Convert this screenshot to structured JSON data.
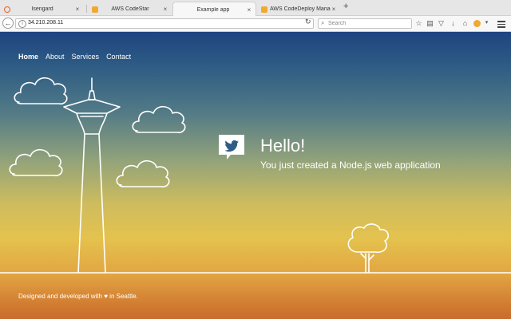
{
  "browser": {
    "tabs": [
      {
        "title": "Isengard"
      },
      {
        "title": "AWS CodeStar"
      },
      {
        "title": "Example app"
      },
      {
        "title": "AWS CodeDeploy Manage..."
      }
    ],
    "new_tab_label": "+",
    "url": "34.210.208.11",
    "search_placeholder": "Search",
    "colors": {
      "tab_icon_red": "#e6602f",
      "tab_icon_amber": "#f0a830"
    }
  },
  "site": {
    "nav": [
      "Home",
      "About",
      "Services",
      "Contact"
    ],
    "hello_title": "Hello!",
    "hello_subtitle": "You just created a Node.js web application",
    "footer": "Designed and developed with ♥ in Seattle.",
    "icons": [
      "twitter-bird-icon",
      "space-needle-illustration",
      "cloud-illustration",
      "tree-illustration"
    ]
  }
}
